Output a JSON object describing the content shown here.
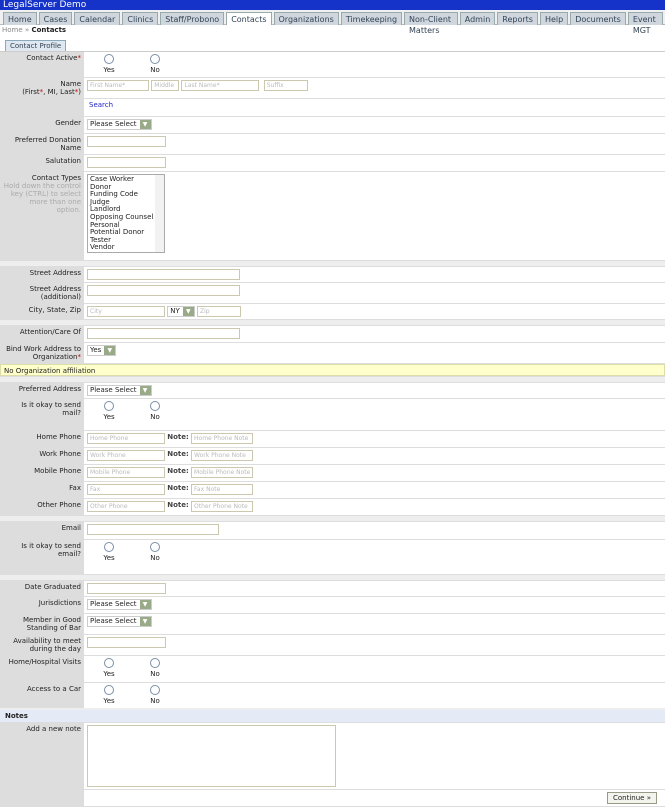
{
  "app_title": "LegalServer Demo",
  "tabs": [
    "Home",
    "Cases",
    "Calendar",
    "Clinics",
    "Staff/Probono",
    "Contacts",
    "Organizations",
    "Timekeeping",
    "Non-Client Matters",
    "Admin",
    "Reports",
    "Help",
    "Documents",
    "Event MGT"
  ],
  "active_tab": "Contacts",
  "breadcrumb": {
    "home": "Home",
    "sep": "»",
    "current": "Contacts"
  },
  "subtab": "Contact Profile",
  "radio": {
    "yes": "Yes",
    "no": "No"
  },
  "labels": {
    "contact_active": "Contact Active",
    "name": "Name",
    "name_sub1": "(First",
    "name_sub2": ", MI, Last",
    "name_sub3": ")",
    "req": "*",
    "gender": "Gender",
    "donation": "Preferred Donation Name",
    "salutation": "Salutation",
    "contact_types": "Contact Types",
    "contact_types_hint": "Hold down the control key (CTRL) to select more than one option.",
    "street": "Street Address",
    "street2": "Street Address (additional)",
    "city": "City, State, Zip",
    "attention": "Attention/Care Of",
    "bind": "Bind Work Address to Organization",
    "pref_address": "Preferred Address",
    "send_mail": "Is it okay to send mail?",
    "home_phone": "Home Phone",
    "work_phone": "Work Phone",
    "mobile_phone": "Mobile Phone",
    "fax": "Fax",
    "other_phone": "Other Phone",
    "note": "Note:",
    "email": "Email",
    "send_email": "Is it okay to send email?",
    "date_grad": "Date Graduated",
    "jurisdictions": "Jurisdictions",
    "good_standing": "Member in Good Standing of Bar",
    "availability": "Availability to meet during the day",
    "home_visits": "Home/Hospital Visits",
    "car": "Access to a Car",
    "add_note": "Add a new note"
  },
  "placeholders": {
    "first": "First Name*",
    "middle": "Middle",
    "last": "Last Name*",
    "suffix": "Suffix",
    "city": "City",
    "zip": "Zip",
    "home_phone": "Home Phone",
    "home_note": "Home Phone Note",
    "work_phone": "Work Phone",
    "work_note": "Work Phone Note",
    "mobile_phone": "Mobile Phone",
    "mobile_note": "Mobile Phone Note",
    "fax": "Fax",
    "fax_note": "Fax Note",
    "other_phone": "Other Phone",
    "other_note": "Other Phone Note"
  },
  "search_link": "Search",
  "please_select": "Please Select",
  "state": "NY",
  "bind_value": "Yes",
  "contact_types": [
    "Case Worker",
    "Donor",
    "Funding Code",
    "Judge",
    "Landlord",
    "Opposing Counsel",
    "Personal",
    "Potential Donor",
    "Tester",
    "Vendor"
  ],
  "no_org": "No Organization affiliation",
  "notes_header": "Notes",
  "continue": "Continue »"
}
